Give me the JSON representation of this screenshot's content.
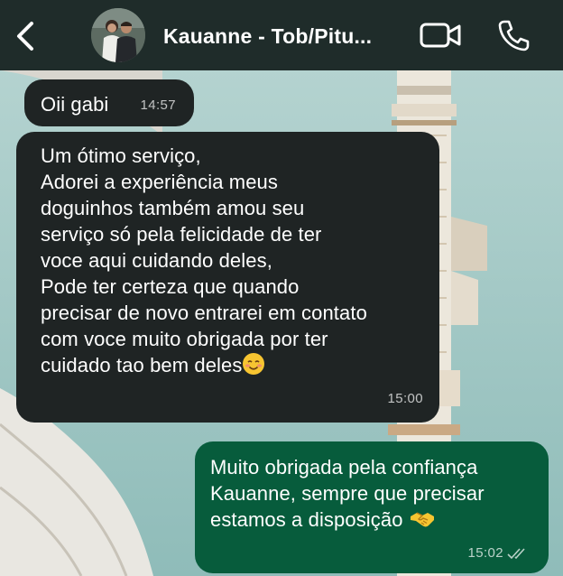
{
  "header": {
    "contact_name": "Kauanne - Tob/Pitu..."
  },
  "icons": {
    "back": "chevron-left-icon",
    "video": "video-camera-icon",
    "call": "phone-icon",
    "read_receipt": "double-check-icon"
  },
  "colors": {
    "header_bg": "#1f2c2a",
    "incoming_bubble": "#1f2424",
    "outgoing_bubble": "#075c3c",
    "wallpaper": "#9fc7c4"
  },
  "messages": [
    {
      "direction": "incoming",
      "text": "Oii gabi",
      "time": "14:57"
    },
    {
      "direction": "incoming",
      "text": "Um ótimo serviço,\nAdorei a experiência meus\ndoguinhos também amou seu\nserviço só pela felicidade de ter\nvoce aqui cuidando deles,\nPode ter certeza que quando\nprecisar de novo entrarei em contato\ncom voce muito obrigada por ter\ncuidado tao bem deles",
      "emoji": "smiling-face-emoji",
      "time": "15:00"
    },
    {
      "direction": "outgoing",
      "text": "Muito obrigada pela confiança\nKauanne, sempre que precisar\nestamos a disposição",
      "emoji": "handshake-emoji",
      "time": "15:02"
    }
  ]
}
